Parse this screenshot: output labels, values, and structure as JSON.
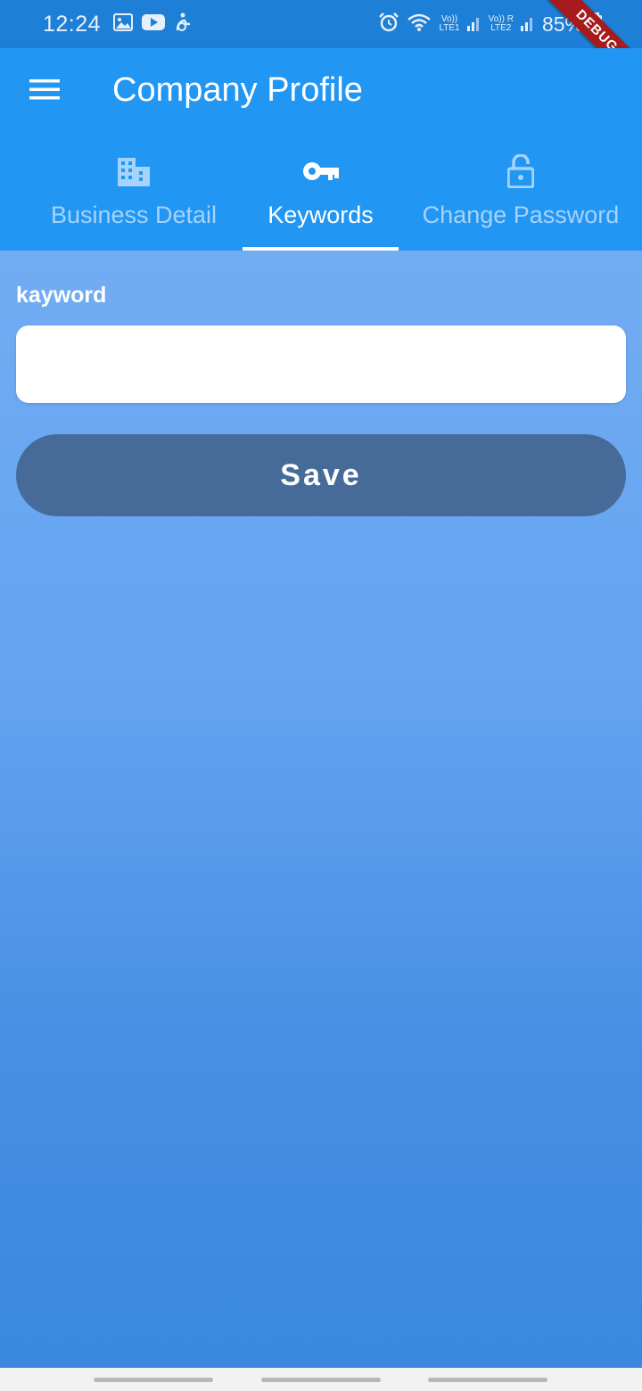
{
  "status_bar": {
    "time": "12:24",
    "battery": "85%",
    "net1": "LTE1",
    "net2": "LTE2",
    "icons": [
      "gallery-icon",
      "youtube-icon",
      "accessibility-icon",
      "alarm-icon",
      "wifi-icon",
      "signal-icon",
      "signal-icon",
      "battery-charging-icon"
    ]
  },
  "debug_banner": "DEBUG",
  "app_bar": {
    "title": "Company Profile",
    "menu_icon": "hamburger-menu-icon"
  },
  "tabs": [
    {
      "label": "Business Detail",
      "icon": "building-icon",
      "active": false
    },
    {
      "label": "Keywords",
      "icon": "key-icon",
      "active": true
    },
    {
      "label": "Change Password",
      "icon": "lock-icon",
      "active": false
    }
  ],
  "form": {
    "field_label": "kayword",
    "input_value": "",
    "save_label": "Save"
  },
  "colors": {
    "status_bar": "#1e7fd6",
    "app_bar": "#2196f3",
    "save_button": "#466b99",
    "debug_banner": "#a61b1b"
  }
}
